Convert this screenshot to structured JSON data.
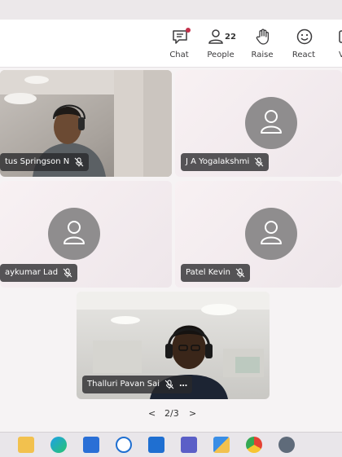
{
  "toolbar": {
    "chat_label": "Chat",
    "people_label": "People",
    "people_count": "22",
    "raise_label": "Raise",
    "react_label": "React",
    "view_label": "V"
  },
  "participants": [
    {
      "name": "tus Springson N",
      "video": true
    },
    {
      "name": "J A Yogalakshmi",
      "video": false
    },
    {
      "name": "aykumar Lad",
      "video": false
    },
    {
      "name": "Patel Kevin",
      "video": false
    },
    {
      "name": "Thalluri Pavan Sai",
      "video": true,
      "more": "…"
    }
  ],
  "pager": {
    "prev": "<",
    "page": "2/3",
    "next": ">"
  },
  "colors": {
    "accent": "#c4314b",
    "name_bg": "#28282a"
  },
  "taskbar": [
    "file-explorer-icon",
    "edge-icon",
    "store-icon",
    "dell-icon",
    "remote-icon",
    "teams-icon",
    "security-icon",
    "chrome-icon",
    "settings-icon"
  ]
}
